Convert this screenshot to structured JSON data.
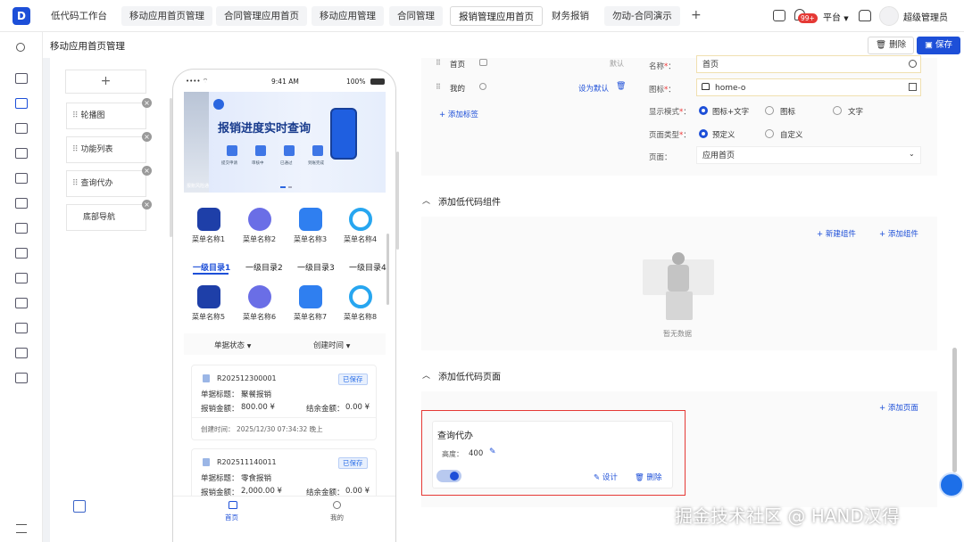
{
  "topbar": {
    "logo": "D",
    "tabs": [
      "低代码工作台",
      "移动应用首页管理",
      "合同管理应用首页",
      "移动应用管理",
      "合同管理",
      "报销管理应用首页",
      "财务报销",
      "勿动-合同演示"
    ],
    "add": "+",
    "badge": "99+",
    "platform": "平台",
    "user": "超级管理员"
  },
  "page": {
    "title": "移动应用首页管理",
    "delete_label": "删除",
    "save_label": "保存"
  },
  "components": {
    "add": "+",
    "items": [
      "轮播图",
      "功能列表",
      "查询代办",
      "底部导航"
    ]
  },
  "phone": {
    "time": "9:41 AM",
    "battery": "100%",
    "banner_title": "报销进度实时查询",
    "banner_steps": [
      "提交申请",
      "审核中",
      "已通过",
      "到账完成"
    ],
    "banner_foot": "报账风险通",
    "menu_row1": [
      "菜单名称1",
      "菜单名称2",
      "菜单名称3",
      "菜单名称4"
    ],
    "categories": [
      "一级目录1",
      "一级目录2",
      "一级目录3",
      "一级目录4"
    ],
    "menu_row2": [
      "菜单名称5",
      "菜单名称6",
      "菜单名称7",
      "菜单名称8"
    ],
    "filters": [
      "单据状态",
      "创建时间"
    ],
    "cards": [
      {
        "no": "R202512300001",
        "status": "已保存",
        "title_label": "单据标题：",
        "title": "聚餐报销",
        "amount_label": "报销金额：",
        "amount": "800.00 ¥",
        "settle_label": "结余金额：",
        "settle": "0.00 ¥",
        "time_label": "创建时间：",
        "time": "2025/12/30 07:34:32 晚上"
      },
      {
        "no": "R202511140011",
        "status": "已保存",
        "title_label": "单据标题：",
        "title": "零食报销",
        "amount_label": "报销金额：",
        "amount": "2,000.00 ¥",
        "settle_label": "结余金额：",
        "settle": "0.00 ¥"
      }
    ],
    "nav": [
      "首页",
      "我的"
    ]
  },
  "nav_config": {
    "rows": [
      {
        "name": "首页",
        "extra": "默认"
      },
      {
        "name": "我的",
        "extra": "设为默认"
      }
    ],
    "add_tag": "添加标签"
  },
  "form": {
    "name_label": "名称",
    "name_value": "首页",
    "icon_label": "图标",
    "icon_value": "home-o",
    "mode_label": "显示模式",
    "mode_options": [
      "图标+文字",
      "图标",
      "文字"
    ],
    "type_label": "页面类型",
    "type_options": [
      "预定义",
      "自定义"
    ],
    "page_label": "页面",
    "page_value": "应用首页"
  },
  "lowcode_components": {
    "title": "添加低代码组件",
    "new_component": "新建组件",
    "add_component": "添加组件",
    "empty": "暂无数据"
  },
  "lowcode_pages": {
    "title": "添加低代码页面",
    "add_page": "添加页面",
    "card_title": "查询代办",
    "height_label": "高度：",
    "height_value": "400",
    "design": "设计",
    "delete": "删除"
  },
  "watermark": "掘金技术社区 @ HAND汉得",
  "colors": {
    "accent": "#1d4fd8",
    "highlight": "#e53935"
  }
}
